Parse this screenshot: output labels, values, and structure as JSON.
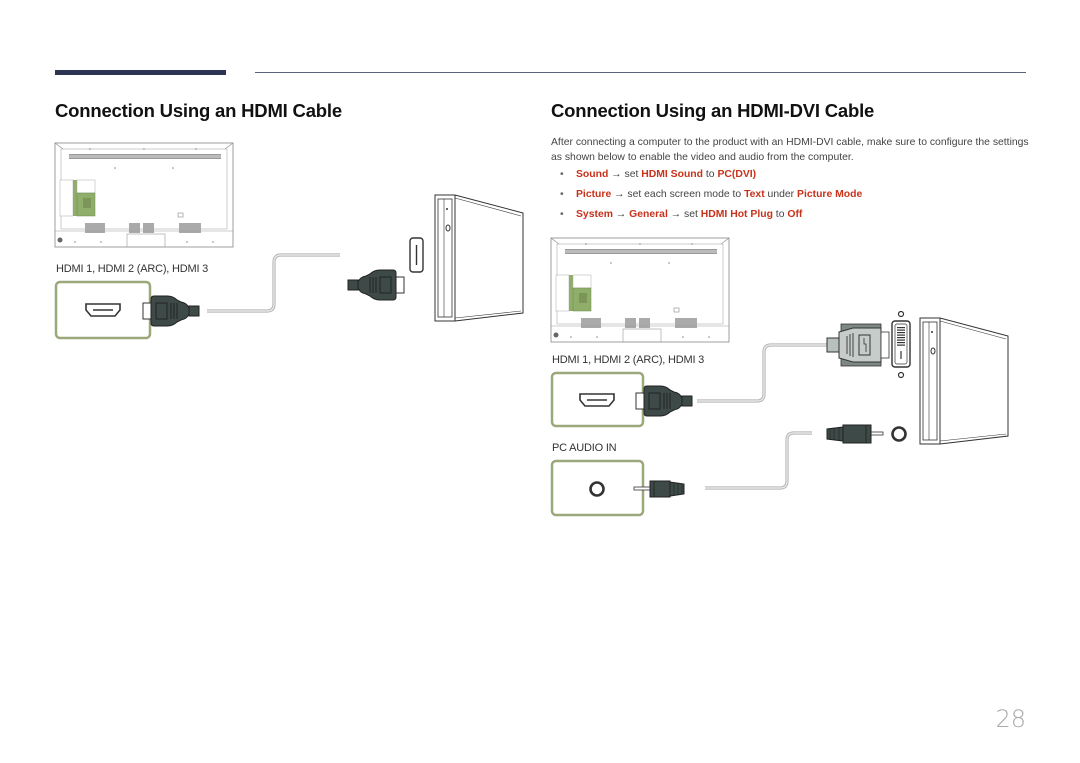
{
  "header": {
    "accent_color": "#2e3552"
  },
  "left_section": {
    "title": "Connection Using an HDMI Cable",
    "port_label": "HDMI 1, HDMI 2 (ARC), HDMI 3",
    "icons": [
      "monitor-back-panel",
      "hdmi-port",
      "hdmi-plug",
      "hdmi-cable",
      "hdmi-plug",
      "hdmi-port",
      "pc-tower"
    ]
  },
  "right_section": {
    "title": "Connection Using an HDMI-DVI Cable",
    "intro": "After connecting a computer to the product with an HDMI-DVI cable, make sure to configure the settings as shown below to enable the video and audio from the computer.",
    "bullets": [
      {
        "parts": [
          {
            "t": "Sound",
            "hl": true
          },
          {
            "t": " → set ",
            "hl": false
          },
          {
            "t": "HDMI Sound",
            "hl": true
          },
          {
            "t": " to ",
            "hl": false
          },
          {
            "t": "PC(DVI)",
            "hl": true
          }
        ]
      },
      {
        "parts": [
          {
            "t": "Picture",
            "hl": true
          },
          {
            "t": " → set each screen mode to ",
            "hl": false
          },
          {
            "t": "Text",
            "hl": true
          },
          {
            "t": " under ",
            "hl": false
          },
          {
            "t": "Picture Mode",
            "hl": true
          }
        ]
      },
      {
        "parts": [
          {
            "t": "System",
            "hl": true
          },
          {
            "t": " → ",
            "hl": false
          },
          {
            "t": "General",
            "hl": true
          },
          {
            "t": " → set ",
            "hl": false
          },
          {
            "t": "HDMI Hot Plug",
            "hl": true
          },
          {
            "t": " to ",
            "hl": false
          },
          {
            "t": "Off",
            "hl": true
          }
        ]
      }
    ],
    "hdmi_port_label": "HDMI 1, HDMI 2 (ARC), HDMI 3",
    "audio_port_label": "PC AUDIO IN",
    "icons": [
      "monitor-back-panel",
      "hdmi-port",
      "hdmi-plug",
      "dvi-plug",
      "dvi-port",
      "audio-jack",
      "audio-plug",
      "audio-port",
      "pc-tower"
    ]
  },
  "colors": {
    "highlight": "#c8321b",
    "port_border": "#9aa87a",
    "plug_body": "#3d4a48",
    "panel_green": "#8fae6a"
  },
  "page_number": "28"
}
